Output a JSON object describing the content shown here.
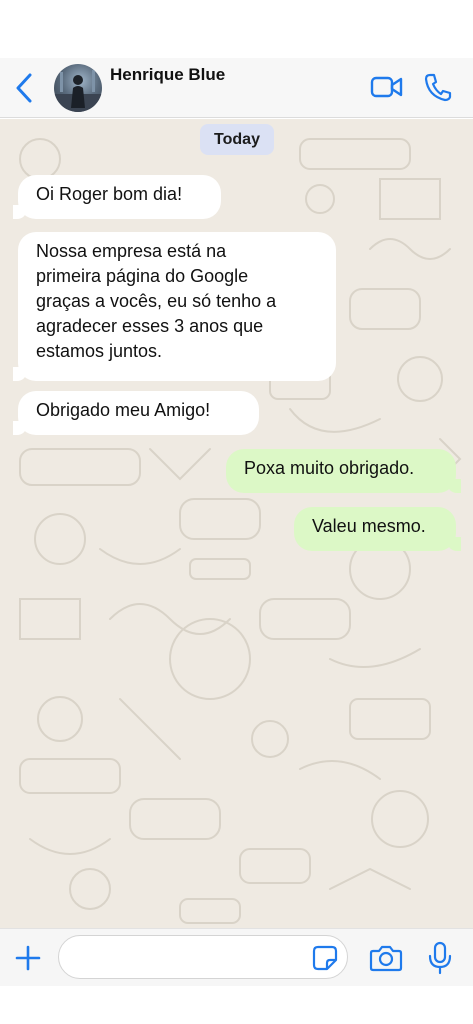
{
  "header": {
    "contact_name": "Henrique Blue",
    "icons": [
      "chevron-left-icon",
      "video-camera-icon",
      "phone-icon"
    ]
  },
  "chat": {
    "date_label": "Today",
    "messages": [
      {
        "direction": "incoming",
        "text": "Oi Roger bom dia!"
      },
      {
        "direction": "incoming",
        "text": "Nossa empresa está na\nprimeira página do Google\ngraças a vocês, eu só tenho a\nagradecer esses 3 anos que\nestamos juntos."
      },
      {
        "direction": "incoming",
        "text": "Obrigado meu Amigo!"
      },
      {
        "direction": "outgoing",
        "text": "Poxa muito obrigado."
      },
      {
        "direction": "outgoing",
        "text": "Valeu mesmo."
      }
    ]
  },
  "composer": {
    "value": "",
    "icons": [
      "plus-icon",
      "sticker-icon",
      "camera-icon",
      "microphone-icon"
    ]
  },
  "colors": {
    "accent": "#1f7aec",
    "chat_background": "#efeae2",
    "incoming_bubble": "#ffffff",
    "outgoing_bubble": "#dcf8c6",
    "date_pill": "#dbe1f4"
  }
}
